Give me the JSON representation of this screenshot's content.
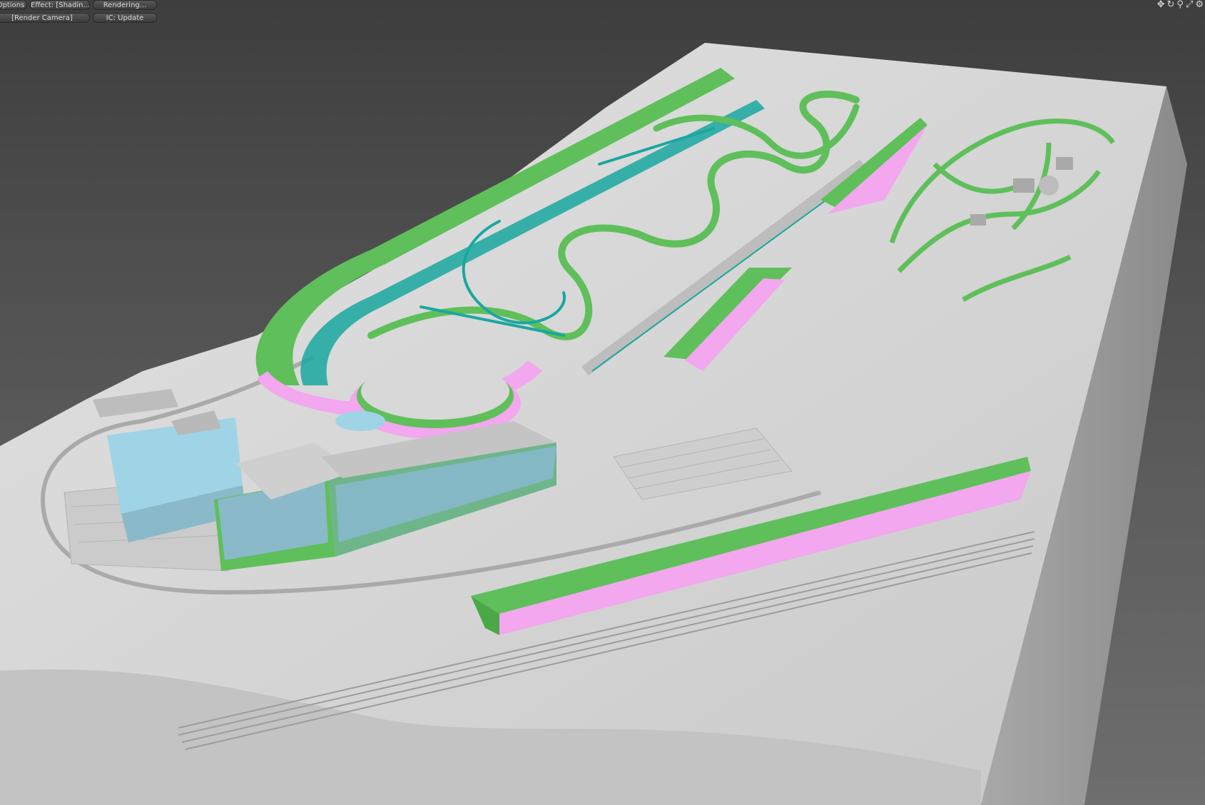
{
  "viewport_toolbar": {
    "options_label": "Options",
    "effect_label": "Effect: [Shadin...",
    "rendering_label": "Rendering...",
    "camera_label": "[Render Camera]",
    "ic_update_label": "IC: Update"
  },
  "nav_icons": {
    "pan": "✥",
    "orbit": "↻",
    "zoom": "⚲",
    "maximize": "⤢",
    "settings": "⚙"
  },
  "colors": {
    "background": "#5e5e5e",
    "terrain": "#d4d4d4",
    "terrain_shadow": "#9a9a9a",
    "track_wall_green": "#5fbf5a",
    "track_edge_teal": "#1aa7a0",
    "pink_pit": "#f2a7ee",
    "glass_blue": "#9fd4e6"
  }
}
